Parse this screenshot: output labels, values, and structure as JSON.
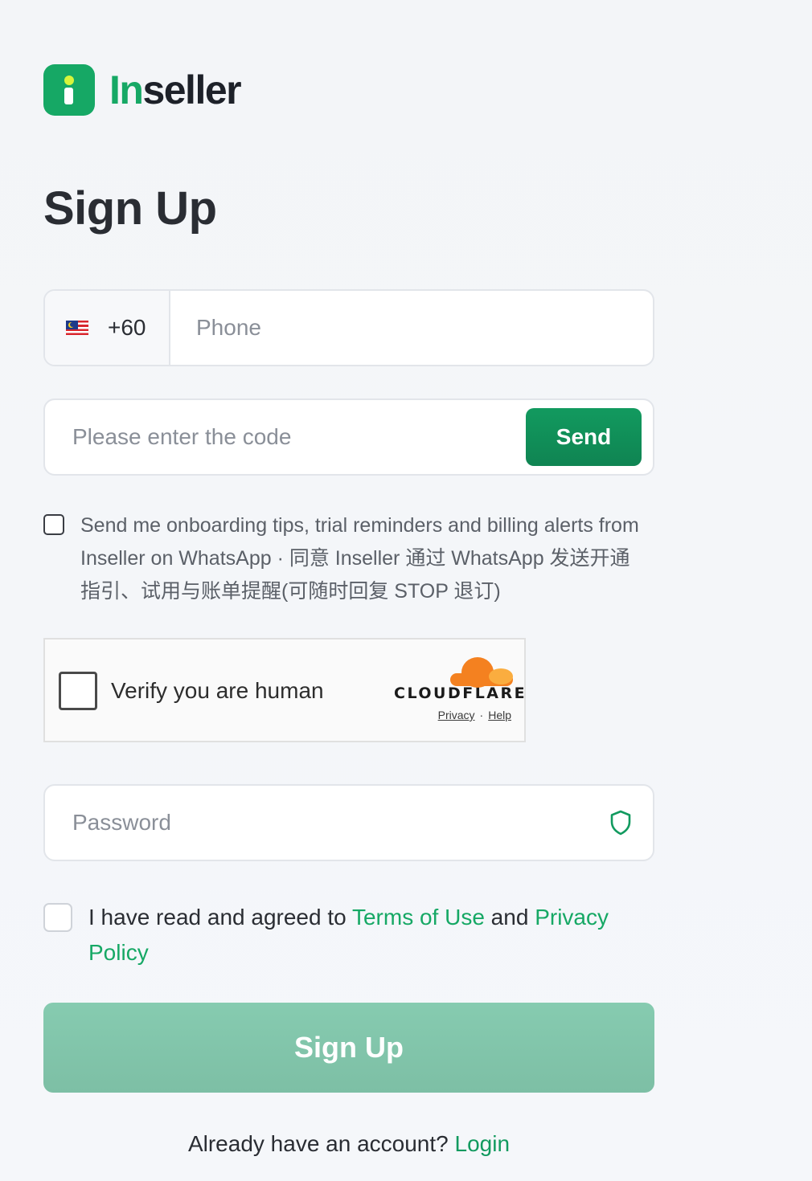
{
  "brand": {
    "name_accent": "In",
    "name_rest": "seller",
    "logo_color": "#16a865"
  },
  "title": "Sign Up",
  "phone": {
    "country_flag": "flag-malaysia-icon",
    "dial_code": "+60",
    "placeholder": "Phone",
    "value": ""
  },
  "code": {
    "placeholder": "Please enter the code",
    "value": "",
    "send_label": "Send"
  },
  "whatsapp_consent": {
    "checked": false,
    "text": "Send me onboarding tips, trial reminders and billing alerts from Inseller on WhatsApp · 同意 Inseller 通过 WhatsApp 发送开通指引、试用与账单提醒(可随时回复 STOP 退订)"
  },
  "captcha": {
    "label": "Verify you are human",
    "provider": "CLOUDFLARE",
    "privacy_link": "Privacy",
    "separator": "·",
    "help_link": "Help"
  },
  "password": {
    "placeholder": "Password",
    "value": "",
    "icon": "shield-icon"
  },
  "terms": {
    "checked": false,
    "prefix": "I have read and agreed to ",
    "terms_link": "Terms of Use",
    "middle": " and ",
    "privacy_link": "Privacy Policy"
  },
  "submit_label": "Sign Up",
  "footer": {
    "prompt": "Already have an account? ",
    "login_link": "Login"
  },
  "colors": {
    "accent": "#16a865",
    "send_button": "#129a5f",
    "submit_disabled": "#86cbb0",
    "cloudflare_orange": "#f48120"
  }
}
